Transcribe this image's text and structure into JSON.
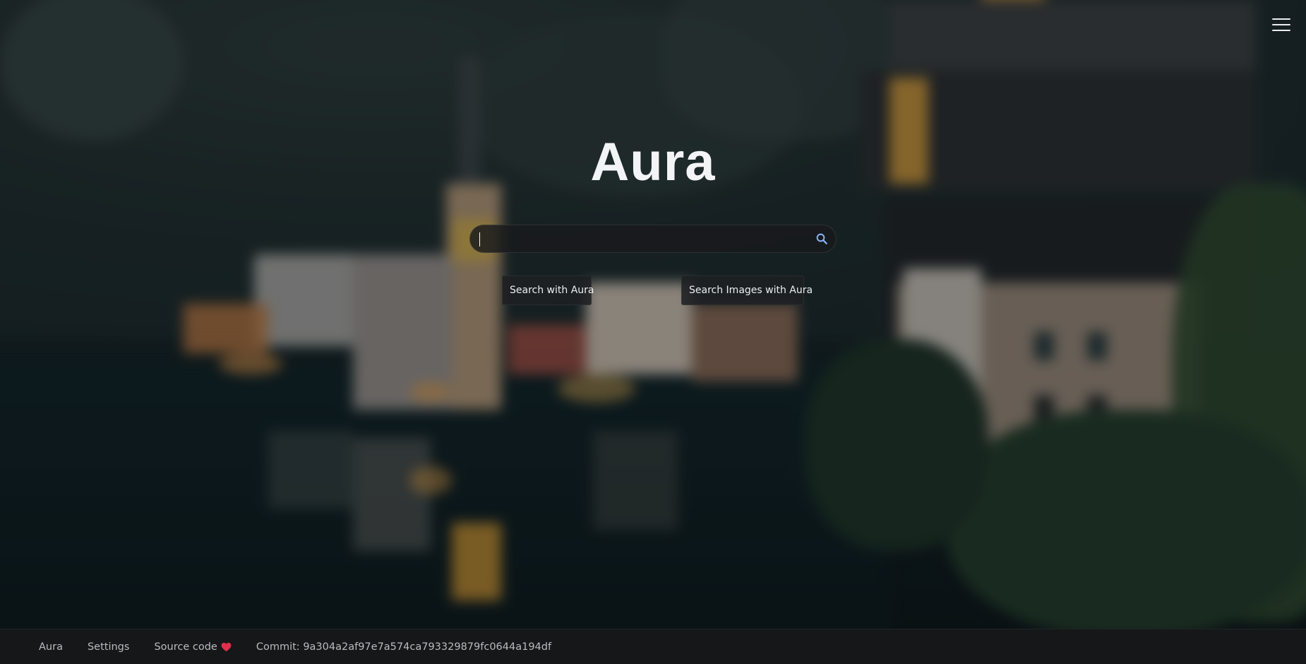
{
  "app": {
    "title": "Aura"
  },
  "search": {
    "value": "",
    "placeholder": "",
    "button_label": "Search with Aura",
    "images_button_label": "Search Images with Aura"
  },
  "footer": {
    "links": {
      "home": "Aura",
      "settings": "Settings",
      "source_code": "Source code"
    },
    "commit_label": "Commit:",
    "commit_hash": "9a304a2af97e7a574ca793329879fc0644a194df"
  },
  "icons": {
    "menu": "hamburger-icon",
    "search": "magnifier-icon",
    "heart": "heart-icon"
  },
  "colors": {
    "search_icon": "#8ab4f8",
    "heart": "#e0304e",
    "footer_bg": "#161718",
    "title": "#f3f4f5"
  }
}
